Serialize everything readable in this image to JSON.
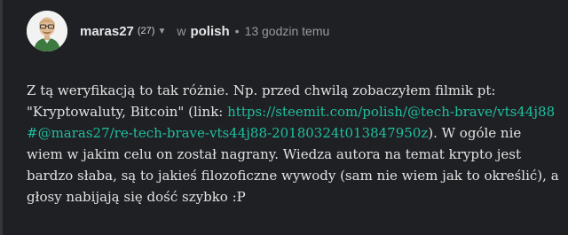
{
  "comment": {
    "author": "maras27",
    "reputation": "(27)",
    "in_label": "w",
    "community": "polish",
    "separator": "•",
    "timestamp": "13 godzin temu",
    "body": {
      "text_before": "Z tą weryfikacją to tak różnie. Np. przed chwilą zobaczyłem filmik pt: \"Kryptowaluty, Bitcoin\" (link: ",
      "link_text": "https://steemit.com/polish/@tech-brave/vts44j88#@maras27/re-tech-brave-vts44j88-20180324t013847950z",
      "text_after": "). W ogóle nie wiem w jakim celu on został nagrany. Wiedza autora na temat krypto jest bardzo słaba, są to jakieś filozoficzne wywody (sam nie wiem jak to określić), a głosy nabijają się dość szybko :P"
    }
  },
  "icons": {
    "avatar": "avatar-icon",
    "caret": "caret-down-icon"
  },
  "colors": {
    "background": "#1f2024",
    "link": "#1fbf9f",
    "text": "#e2e2e2",
    "muted": "#9a9a9a"
  }
}
